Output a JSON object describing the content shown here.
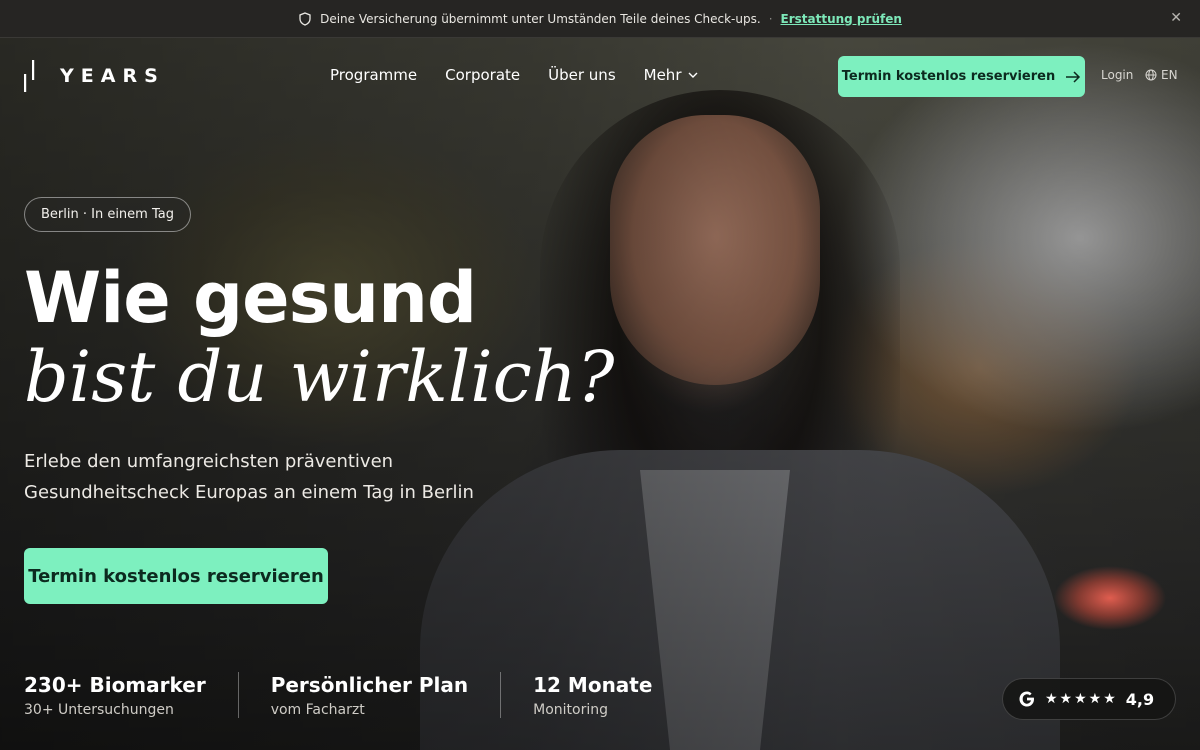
{
  "announcement": {
    "icon": "shield-icon",
    "text": "Deine Versicherung übernimmt unter Umständen Teile deines Check-ups.",
    "separator": "·",
    "link": "Erstattung prüfen",
    "close": "✕"
  },
  "nav": {
    "logo_text": "YEARS",
    "menu": [
      {
        "label": "Programme"
      },
      {
        "label": "Corporate"
      },
      {
        "label": "Über uns"
      },
      {
        "label": "Mehr"
      }
    ],
    "cta": "Termin kostenlos reservieren",
    "login": "Login",
    "language": "EN"
  },
  "hero": {
    "pill": "Berlin · In einem Tag",
    "headline_line1": "Wie gesund",
    "headline_line2": "bist du wirklich?",
    "subtitle": "Erlebe den umfangreichsten präventiven Gesundheitscheck Europas an einem Tag in Berlin",
    "cta": "Termin kostenlos reservieren"
  },
  "stats": [
    {
      "value": "230+ Biomarker",
      "label": "30+ Untersuchungen"
    },
    {
      "value": "Persönlicher Plan",
      "label": "vom Facharzt"
    },
    {
      "value": "12 Monate",
      "label": "Monitoring"
    }
  ],
  "rating": {
    "icon": "google-icon",
    "stars": "★★★★★",
    "score": "4,9"
  },
  "colors": {
    "accent": "#7df0bf",
    "link": "#7de8b9",
    "topbar": "#262523"
  }
}
